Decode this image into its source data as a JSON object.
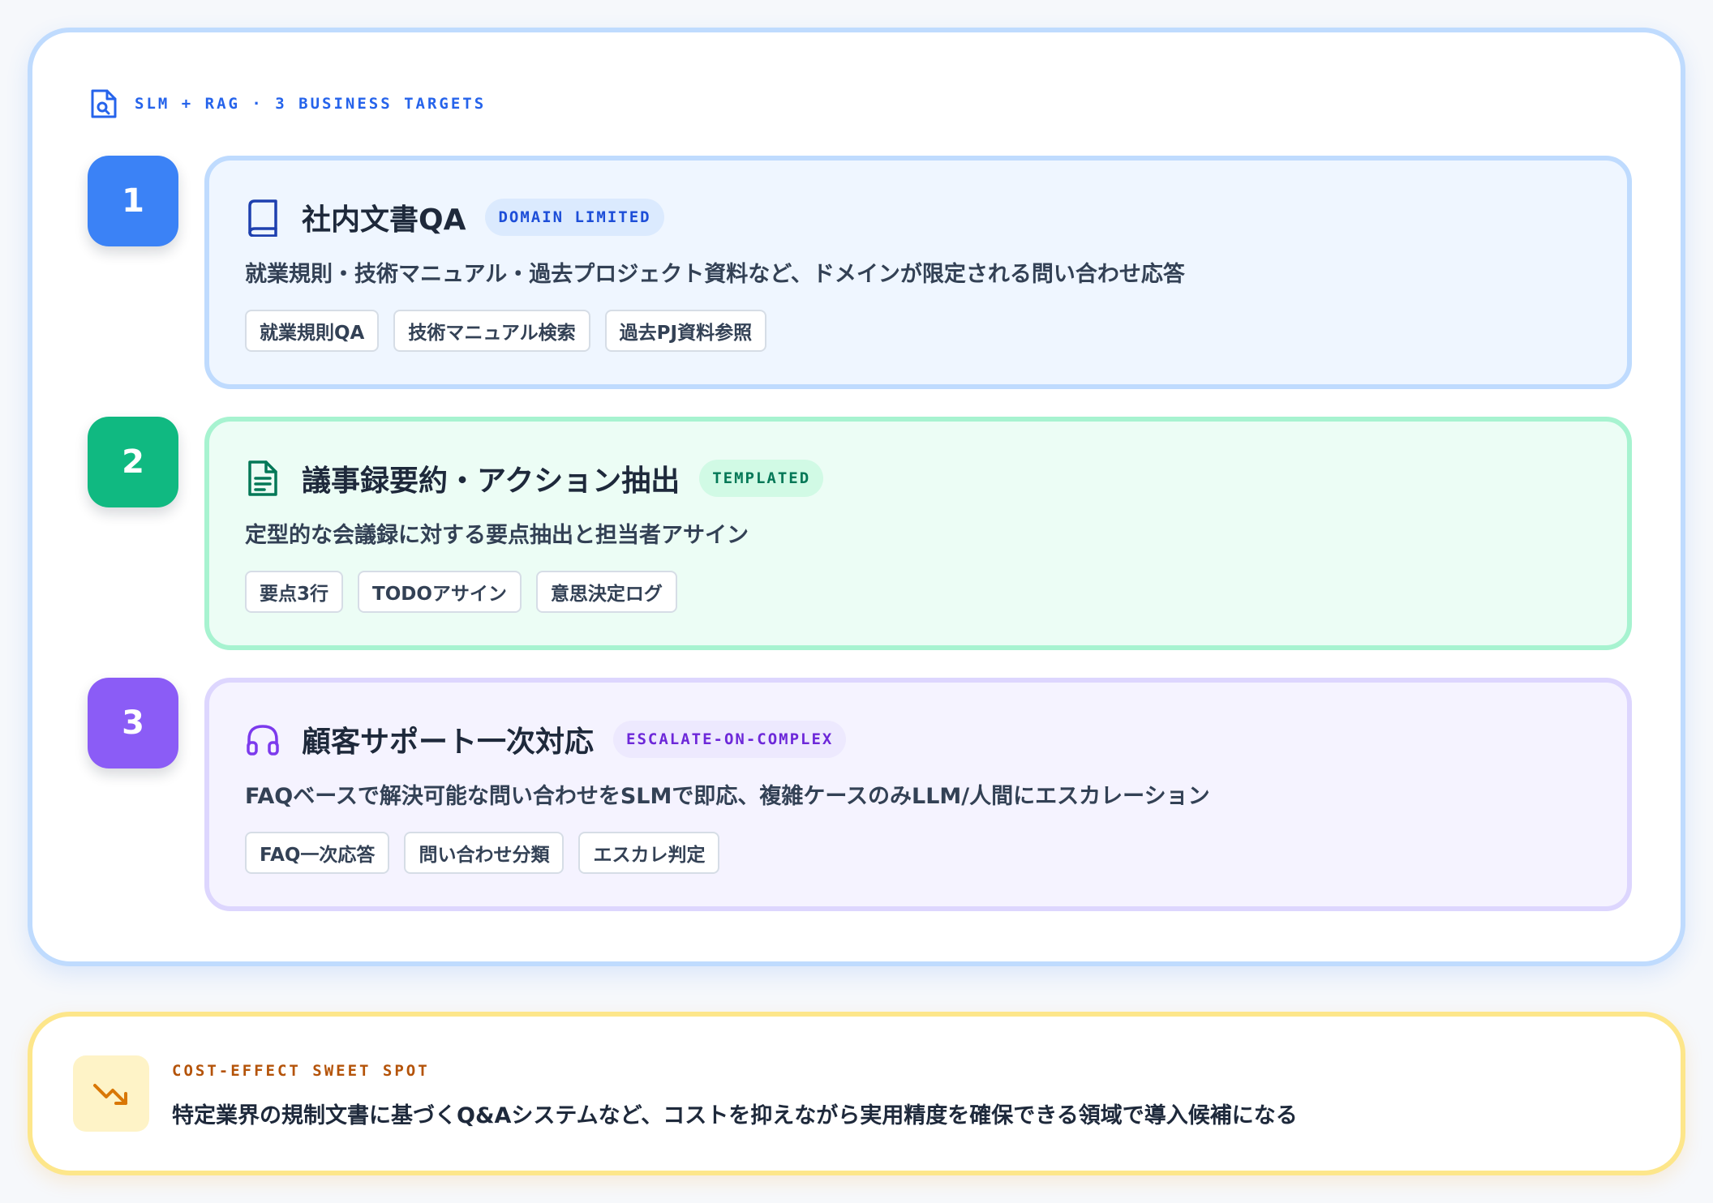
{
  "header": {
    "eyebrow": "SLM + RAG · 3 BUSINESS TARGETS",
    "icon": "file-search-icon"
  },
  "colors": {
    "blue": "#3b82f6",
    "green": "#10b981",
    "purple": "#8b5cf6",
    "amber": "#d97706"
  },
  "targets": [
    {
      "number": "1",
      "icon": "book-icon",
      "title": "社内文書QA",
      "badge": "DOMAIN LIMITED",
      "description": "就業規則・技術マニュアル・過去プロジェクト資料など、ドメインが限定される問い合わせ応答",
      "tags": [
        "就業規則QA",
        "技術マニュアル検索",
        "過去PJ資料参照"
      ]
    },
    {
      "number": "2",
      "icon": "document-icon",
      "title": "議事録要約・アクション抽出",
      "badge": "TEMPLATED",
      "description": "定型的な会議録に対する要点抽出と担当者アサイン",
      "tags": [
        "要点3行",
        "TODOアサイン",
        "意思決定ログ"
      ]
    },
    {
      "number": "3",
      "icon": "headset-icon",
      "title": "顧客サポート一次対応",
      "badge": "ESCALATE-ON-COMPLEX",
      "description": "FAQベースで解決可能な問い合わせをSLMで即応、複雑ケースのみLLM/人間にエスカレーション",
      "tags": [
        "FAQ一次応答",
        "問い合わせ分類",
        "エスカレ判定"
      ]
    }
  ],
  "callout": {
    "icon": "trending-down-icon",
    "label": "COST-EFFECT SWEET SPOT",
    "text": "特定業界の規制文書に基づくQ&Aシステムなど、コストを抑えながら実用精度を確保できる領域で導入候補になる"
  }
}
